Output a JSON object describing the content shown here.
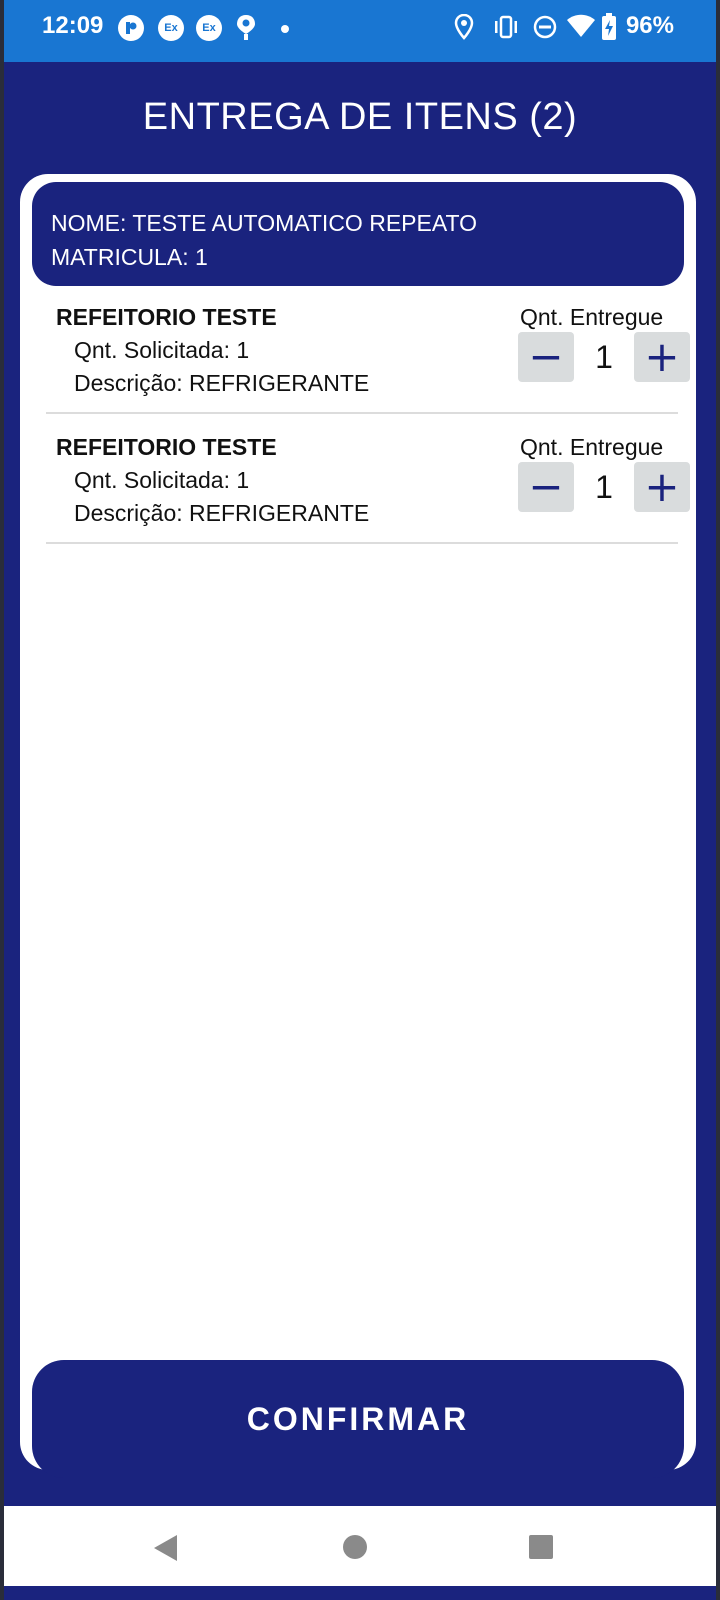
{
  "status_bar": {
    "time": "12:09",
    "battery": "96%",
    "badge_ex1": "Ex",
    "badge_ex2": "Ex"
  },
  "header": {
    "title": "ENTREGA DE ITENS (2)"
  },
  "user": {
    "name_line": "NOME: TESTE AUTOMATICO REPEATO",
    "registration_line": "MATRICULA: 1"
  },
  "items": [
    {
      "title": "REFEITORIO TESTE",
      "requested": "Qnt. Solicitada: 1",
      "description": "Descrição: REFRIGERANTE",
      "delivered_label": "Qnt. Entregue",
      "delivered_value": "1",
      "minus": "−",
      "plus": "+"
    },
    {
      "title": "REFEITORIO TESTE",
      "requested": "Qnt. Solicitada: 1",
      "description": "Descrição: REFRIGERANTE",
      "delivered_label": "Qnt. Entregue",
      "delivered_value": "1",
      "minus": "−",
      "plus": "+"
    }
  ],
  "confirm_label": "CONFIRMAR",
  "colors": {
    "primary": "#1a237e",
    "status_bar": "#1976d2",
    "stepper_bg": "#d9dcdd"
  },
  "icons": {
    "status": [
      "app-icon",
      "exchange-icon",
      "exchange-icon",
      "location-pin-icon",
      "dot-icon",
      "location-icon",
      "vibrate-icon",
      "do-not-disturb-icon",
      "wifi-icon",
      "battery-charging-icon"
    ],
    "nav": [
      "back-icon",
      "home-icon",
      "recents-icon"
    ]
  }
}
